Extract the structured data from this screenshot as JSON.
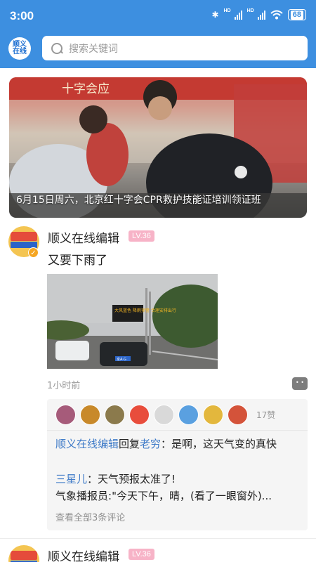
{
  "status_bar": {
    "time": "3:00",
    "battery": "68",
    "network": "HD"
  },
  "header": {
    "logo_text": "顺义在线",
    "search_placeholder": "搜索关键词"
  },
  "banner": {
    "caption": "6月15日周六，北京红十字会CPR救护技能证培训领证班",
    "sign_text": "十字会应"
  },
  "posts": [
    {
      "author": "顺义在线编辑",
      "level": "LV.36",
      "text": "又要下雨了",
      "photo_sign": "大风蓝色 降雨预警 合理安排出行",
      "photo_plate": "京A·G",
      "time_ago": "1小时前",
      "likes_count": "17赞",
      "like_avatars": [
        "#a65b7a",
        "#c8892a",
        "#8b7a4c",
        "#e84d3c",
        "#d9d9d9",
        "#5aa0e0",
        "#e3b73d",
        "#d4533a"
      ],
      "comments": [
        {
          "name": "顺义在线编辑",
          "verb": "回复",
          "target": "老穷",
          "text": "：是啊，这天气变的真快"
        },
        {
          "name": "三星儿",
          "text": "：天气预报太准了!"
        },
        {
          "name": "气象播报员",
          "text": ":\"今天下午，晴，(看了一眼窗外)..."
        }
      ],
      "view_all": "查看全部3条评论"
    },
    {
      "author": "顺义在线编辑",
      "level": "LV.36"
    }
  ]
}
